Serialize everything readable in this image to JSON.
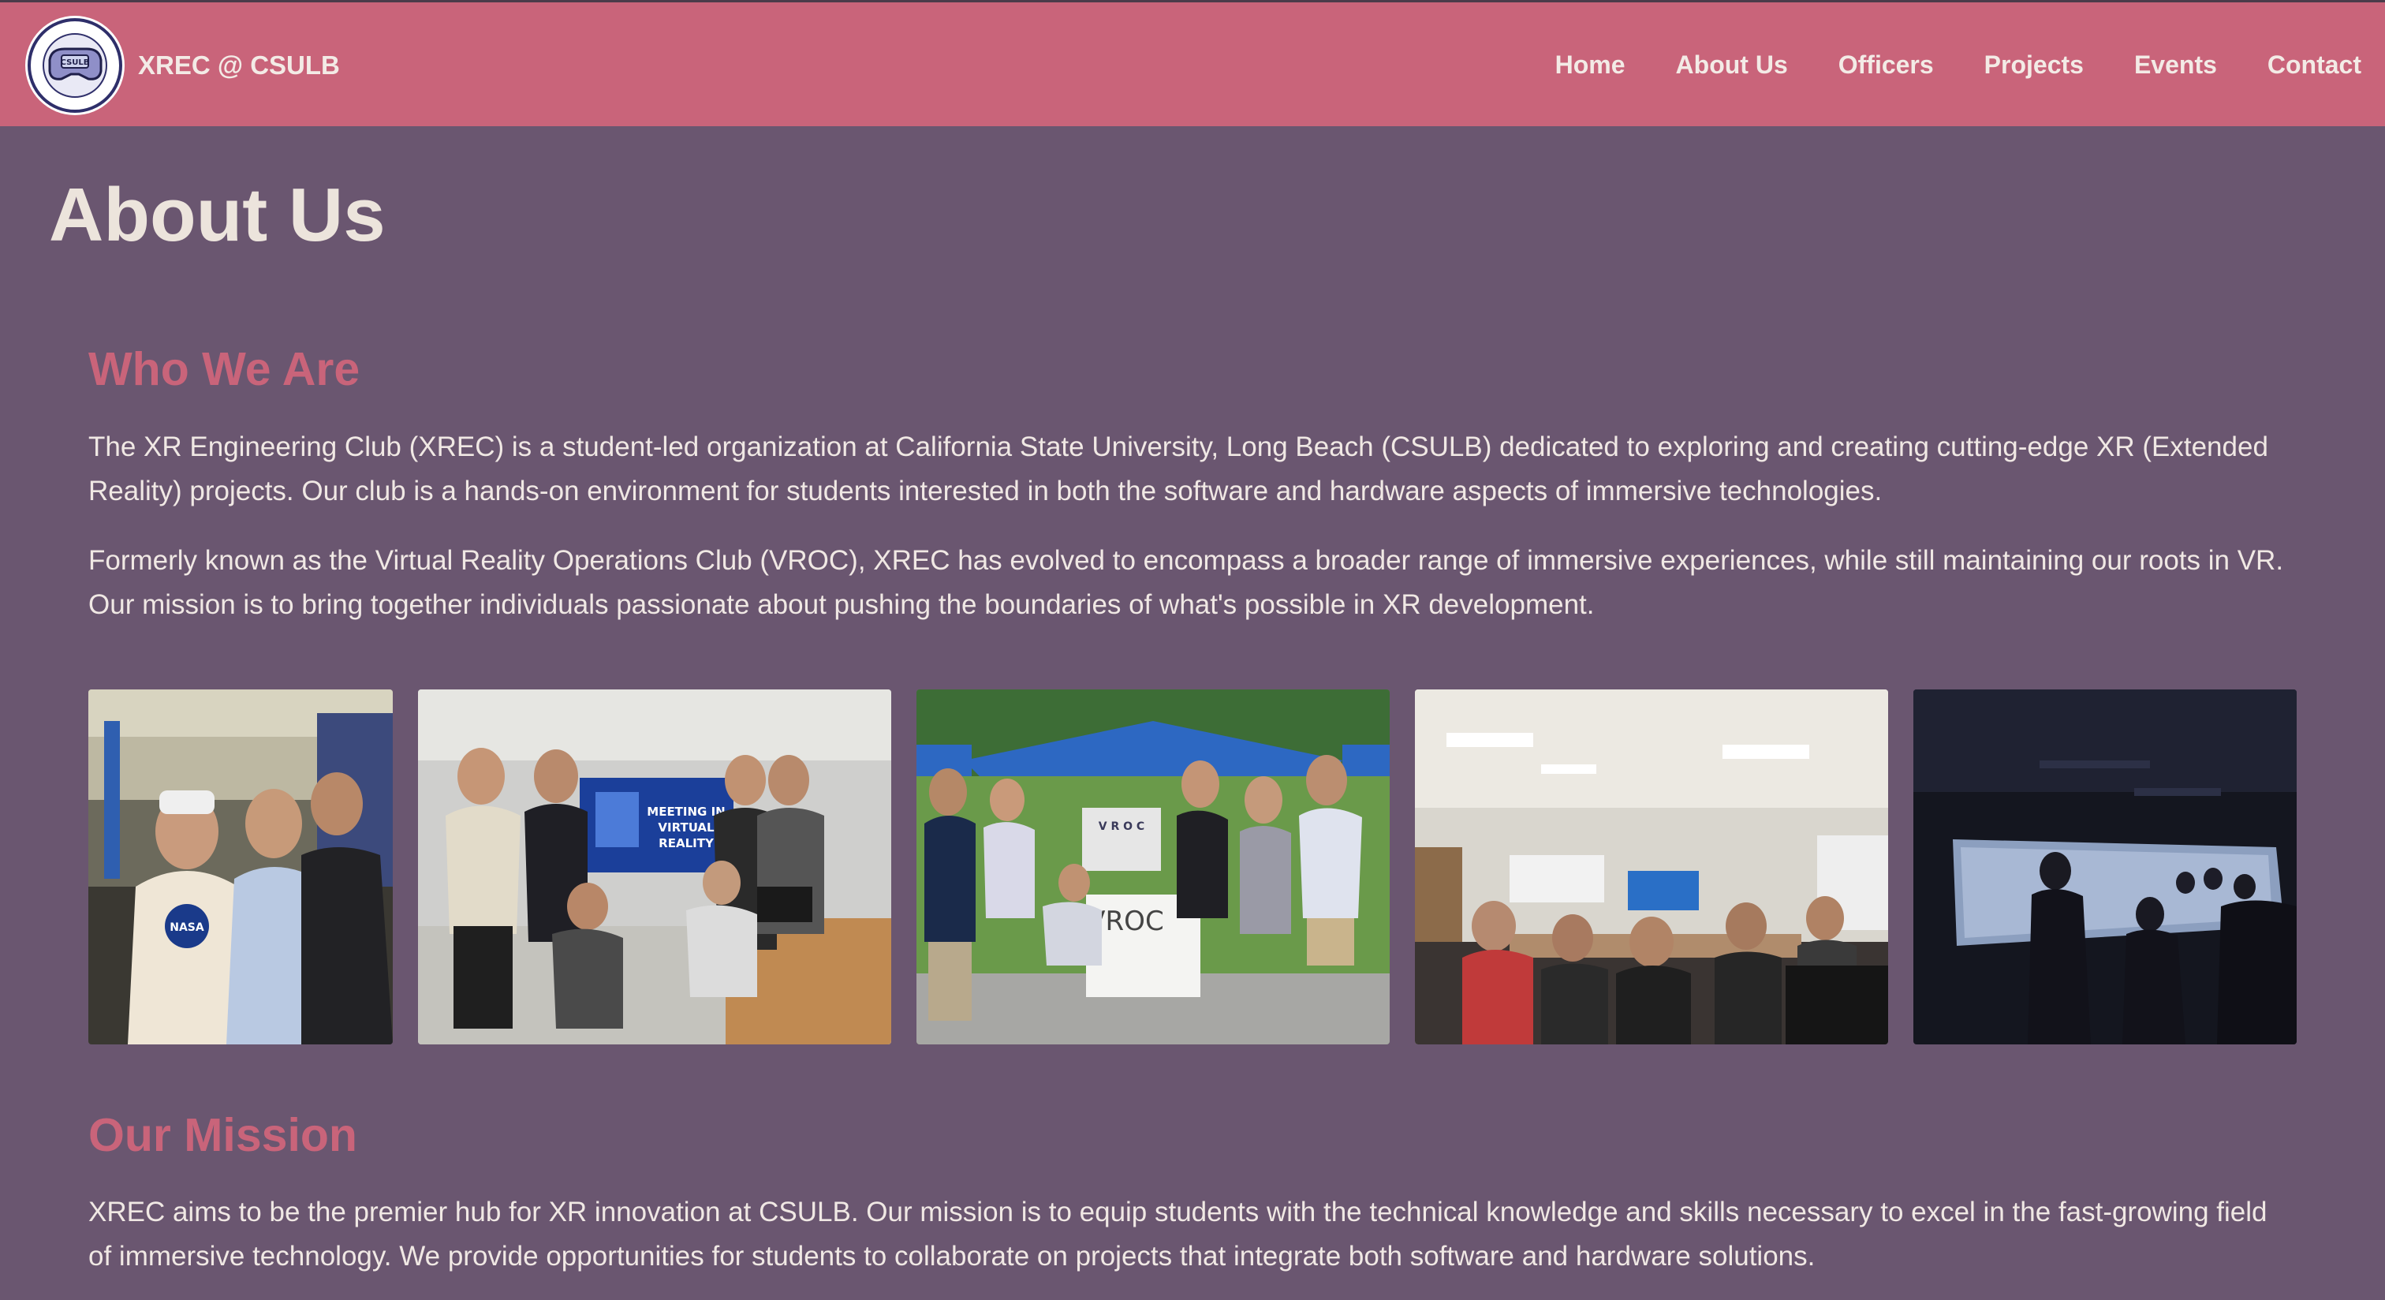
{
  "brand": {
    "name": "XREC @ CSULB",
    "logo_text_outer": "Virtual Reality Operations Club",
    "logo_text_center": "CSULB"
  },
  "nav": {
    "items": [
      {
        "label": "Home"
      },
      {
        "label": "About Us"
      },
      {
        "label": "Officers"
      },
      {
        "label": "Projects"
      },
      {
        "label": "Events"
      },
      {
        "label": "Contact"
      }
    ]
  },
  "page": {
    "title": "About Us"
  },
  "who_we_are": {
    "heading": "Who We Are",
    "paragraphs": [
      "The XR Engineering Club (XREC) is a student-led organization at California State University, Long Beach (CSULB) dedicated to exploring and creating cutting-edge XR (Extended Reality) projects. Our club is a hands-on environment for students interested in both the software and hardware aspects of immersive technologies.",
      "Formerly known as the Virtual Reality Operations Club (VROC), XREC has evolved to encompass a broader range of immersive experiences, while still maintaining our roots in VR. Our mission is to bring together individuals passionate about pushing the boundaries of what's possible in XR development."
    ]
  },
  "gallery": {
    "photos": [
      {
        "name": "photo-lab-students"
      },
      {
        "name": "photo-meeting-in-vr",
        "screen_text": "MEETING IN VIRTUAL REALITY"
      },
      {
        "name": "photo-outdoor-booth",
        "sign_text": "VROC"
      },
      {
        "name": "photo-classroom-meeting"
      },
      {
        "name": "photo-dark-projection-room"
      }
    ]
  },
  "our_mission": {
    "heading": "Our Mission",
    "paragraph": "XREC aims to be the premier hub for XR innovation at CSULB. Our mission is to equip students with the technical knowledge and skills necessary to excel in the fast-growing field of immersive technology. We provide opportunities for students to collaborate on projects that integrate both software and hardware solutions."
  },
  "colors": {
    "navbar": "#c9647a",
    "background": "#6a5670",
    "heading_accent": "#c9647a",
    "title_text": "#ece4dc",
    "body_text": "#f0e8e4"
  }
}
